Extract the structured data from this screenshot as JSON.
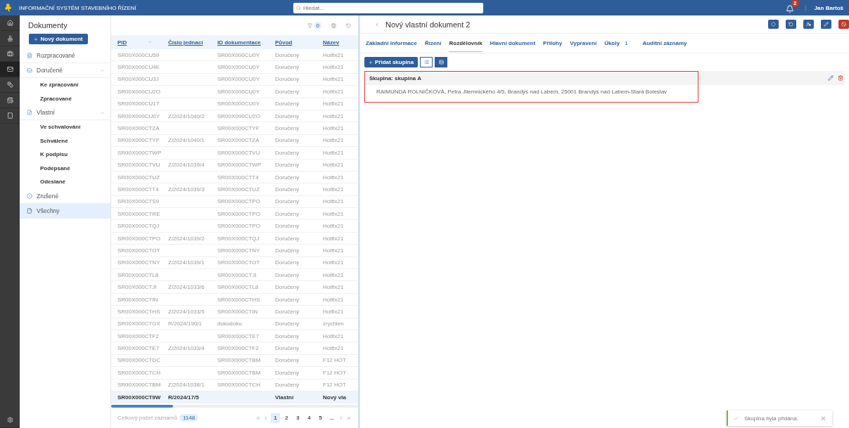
{
  "header": {
    "title": "INFORMAČNÍ SYSTÉM STAVEBNÍHO ŘÍZENÍ",
    "search_placeholder": "Hledat...",
    "notifications": "2",
    "user": "Jan Bartoš"
  },
  "rail": [
    {
      "selected": false
    },
    {
      "selected": false
    },
    {
      "selected": false
    },
    {
      "selected": true
    },
    {
      "selected": false
    },
    {
      "selected": false
    },
    {
      "selected": false
    }
  ],
  "sidebar": {
    "title": "Dokumenty",
    "new_button": "Nový dokument",
    "items": [
      {
        "label": "Rozpracované",
        "selected": false
      },
      {
        "label": "Doručené",
        "selected": false,
        "expanded": true,
        "children": [
          {
            "label": "Ke zpracování",
            "selected": false
          },
          {
            "label": "Zpracované",
            "selected": false
          }
        ]
      },
      {
        "label": "Vlastní",
        "selected": false,
        "expanded": true,
        "children": [
          {
            "label": "Ve schvalování",
            "selected": false
          },
          {
            "label": "Schválené",
            "selected": false
          },
          {
            "label": "K podpisu",
            "selected": false
          },
          {
            "label": "Podepsané",
            "selected": false
          },
          {
            "label": "Odeslané",
            "selected": false
          }
        ]
      },
      {
        "label": "Zrušené",
        "selected": false
      },
      {
        "label": "Všechny",
        "selected": true
      }
    ]
  },
  "table": {
    "filter_count": "0",
    "columns": [
      "PID",
      "Číslo jednací",
      "ID dokumentace",
      "Původ",
      "Název"
    ],
    "rows": [
      {
        "cells": [
          "SR00X000CU59",
          "",
          "SR00X000CU0Y",
          "Doručený",
          "Hotfix21"
        ],
        "selected": false
      },
      {
        "cells": [
          "SR00X000CU4E",
          "",
          "SR00X000CU0Y",
          "Doručený",
          "Hotfix21"
        ],
        "selected": false
      },
      {
        "cells": [
          "SR00X000CU3J",
          "",
          "SR00X000CU0Y",
          "Doručený",
          "Hotfix21"
        ],
        "selected": false
      },
      {
        "cells": [
          "SR00X000CU2O",
          "",
          "SR00X000CU0Y",
          "Doručený",
          "Hotfix21"
        ],
        "selected": false
      },
      {
        "cells": [
          "SR00X000CU1T",
          "",
          "SR00X000CU0Y",
          "Doručený",
          "Hotfix21"
        ],
        "selected": false
      },
      {
        "cells": [
          "SR00X000CU0Y",
          "Z/2024/1040/2",
          "SR00X000CU2O",
          "Doručený",
          "Hotfix21"
        ],
        "selected": false
      },
      {
        "cells": [
          "SR00X000CTZA",
          "",
          "SR00X000CTYF",
          "Doručený",
          "Hotfix21"
        ],
        "selected": false
      },
      {
        "cells": [
          "SR00X000CTYF",
          "Z/2024/1040/1",
          "SR00X000CTZA",
          "Doručený",
          "Hotfix21"
        ],
        "selected": false
      },
      {
        "cells": [
          "SR00X000CTWP",
          "",
          "SR00X000CTVU",
          "Doručený",
          "Hotfix21"
        ],
        "selected": false
      },
      {
        "cells": [
          "SR00X000CTVU",
          "Z/2024/1039/4",
          "SR00X000CTWP",
          "Doručený",
          "Hotfix21"
        ],
        "selected": false
      },
      {
        "cells": [
          "SR00X000CTUZ",
          "",
          "SR00X000CTT4",
          "Doručený",
          "Hotfix21"
        ],
        "selected": false
      },
      {
        "cells": [
          "SR00X000CTT4",
          "Z/2024/1039/3",
          "SR00X000CTUZ",
          "Doručený",
          "Hotfix21"
        ],
        "selected": false
      },
      {
        "cells": [
          "SR00X000CTS9",
          "",
          "SR00X000CTPO",
          "Doručený",
          "Hotfix21"
        ],
        "selected": false
      },
      {
        "cells": [
          "SR00X000CTRE",
          "",
          "SR00X000CTPO",
          "Doručený",
          "Hotfix21"
        ],
        "selected": false
      },
      {
        "cells": [
          "SR00X000CTQJ",
          "",
          "SR00X000CTPO",
          "Doručený",
          "Hotfix21"
        ],
        "selected": false
      },
      {
        "cells": [
          "SR00X000CTPO",
          "Z/2024/1039/2",
          "SR00X000CTQJ",
          "Doručený",
          "Hotfix21"
        ],
        "selected": false
      },
      {
        "cells": [
          "SR00X000CTOT",
          "",
          "SR00X000CTNY",
          "Doručený",
          "Hotfix21"
        ],
        "selected": false
      },
      {
        "cells": [
          "SR00X000CTNY",
          "Z/2024/1039/1",
          "SR00X000CTOT",
          "Doručený",
          "Hotfix21"
        ],
        "selected": false
      },
      {
        "cells": [
          "SR00X000CTL8",
          "",
          "SR00X000CTJI",
          "Doručený",
          "Hotfix21"
        ],
        "selected": false
      },
      {
        "cells": [
          "SR00X000CTJI",
          "Z/2024/1033/6",
          "SR00X000CTL8",
          "Doručený",
          "Hotfix21"
        ],
        "selected": false
      },
      {
        "cells": [
          "SR00X000CTIN",
          "",
          "SR00X000CTHS",
          "Doručený",
          "Hotfix21"
        ],
        "selected": false
      },
      {
        "cells": [
          "SR00X000CTHS",
          "Z/2024/1033/5",
          "SR00X000CTIN",
          "Doručený",
          "Hotfix21"
        ],
        "selected": false
      },
      {
        "cells": [
          "SR00X000CTGX",
          "R/2024/190/1",
          "dokudoku",
          "Doručený",
          "zrychlen"
        ],
        "selected": false
      },
      {
        "cells": [
          "SR00X000CTF2",
          "",
          "SR00X000CTE7",
          "Doručený",
          "Hotfix21"
        ],
        "selected": false
      },
      {
        "cells": [
          "SR00X000CTE7",
          "Z/2024/1033/4",
          "SR00X000CTF2",
          "Doručený",
          "Hotfix21"
        ],
        "selected": false
      },
      {
        "cells": [
          "SR00X000CTDC",
          "",
          "SR00X000CTBM",
          "Doručený",
          "F12 HOT"
        ],
        "selected": false
      },
      {
        "cells": [
          "SR00X000CTCH",
          "",
          "SR00X000CTBM",
          "Doručený",
          "F12 HOT"
        ],
        "selected": false
      },
      {
        "cells": [
          "SR00X000CTBM",
          "Z/2024/1038/1",
          "SR00X000CTCH",
          "Doručený",
          "F12 HOT"
        ],
        "selected": false
      },
      {
        "cells": [
          "SR00X000CT9W",
          "R/2024/17/5",
          "",
          "Vlastní",
          "Nový vla"
        ],
        "selected": true
      }
    ],
    "total_label": "Celkový počet záznamů",
    "total": "1148",
    "pages": [
      {
        "label": "1",
        "selected": true
      },
      {
        "label": "2",
        "selected": false
      },
      {
        "label": "3",
        "selected": false
      },
      {
        "label": "4",
        "selected": false
      },
      {
        "label": "5",
        "selected": false
      },
      {
        "label": "...",
        "selected": false
      }
    ]
  },
  "detail": {
    "title": "Nový vlastní dokument 2",
    "tabs": [
      {
        "label": "Základní informace",
        "selected": false
      },
      {
        "label": "Řízení",
        "selected": false
      },
      {
        "label": "Rozdělovník",
        "selected": true
      },
      {
        "label": "Hlavní dokument",
        "selected": false
      },
      {
        "label": "Přílohy",
        "selected": false
      },
      {
        "label": "Vypravení",
        "selected": false
      },
      {
        "label": "Úkoly",
        "selected": false,
        "count": "1"
      },
      {
        "label": "Auditní záznamy",
        "selected": false
      }
    ],
    "add_button": "Přidat skupina",
    "views": [
      {
        "selected": false
      },
      {
        "selected": true
      }
    ],
    "group": {
      "title": "Skupina: skupina A",
      "member": "RAIMUNDA ROLNIČKOVÁ, Petra Jilemnického 4/5, Brandýs nad Labem, 25001 Brandýs nad Labem-Stará Boleslav"
    }
  },
  "toast": {
    "message": "Skupina byla přidána."
  }
}
